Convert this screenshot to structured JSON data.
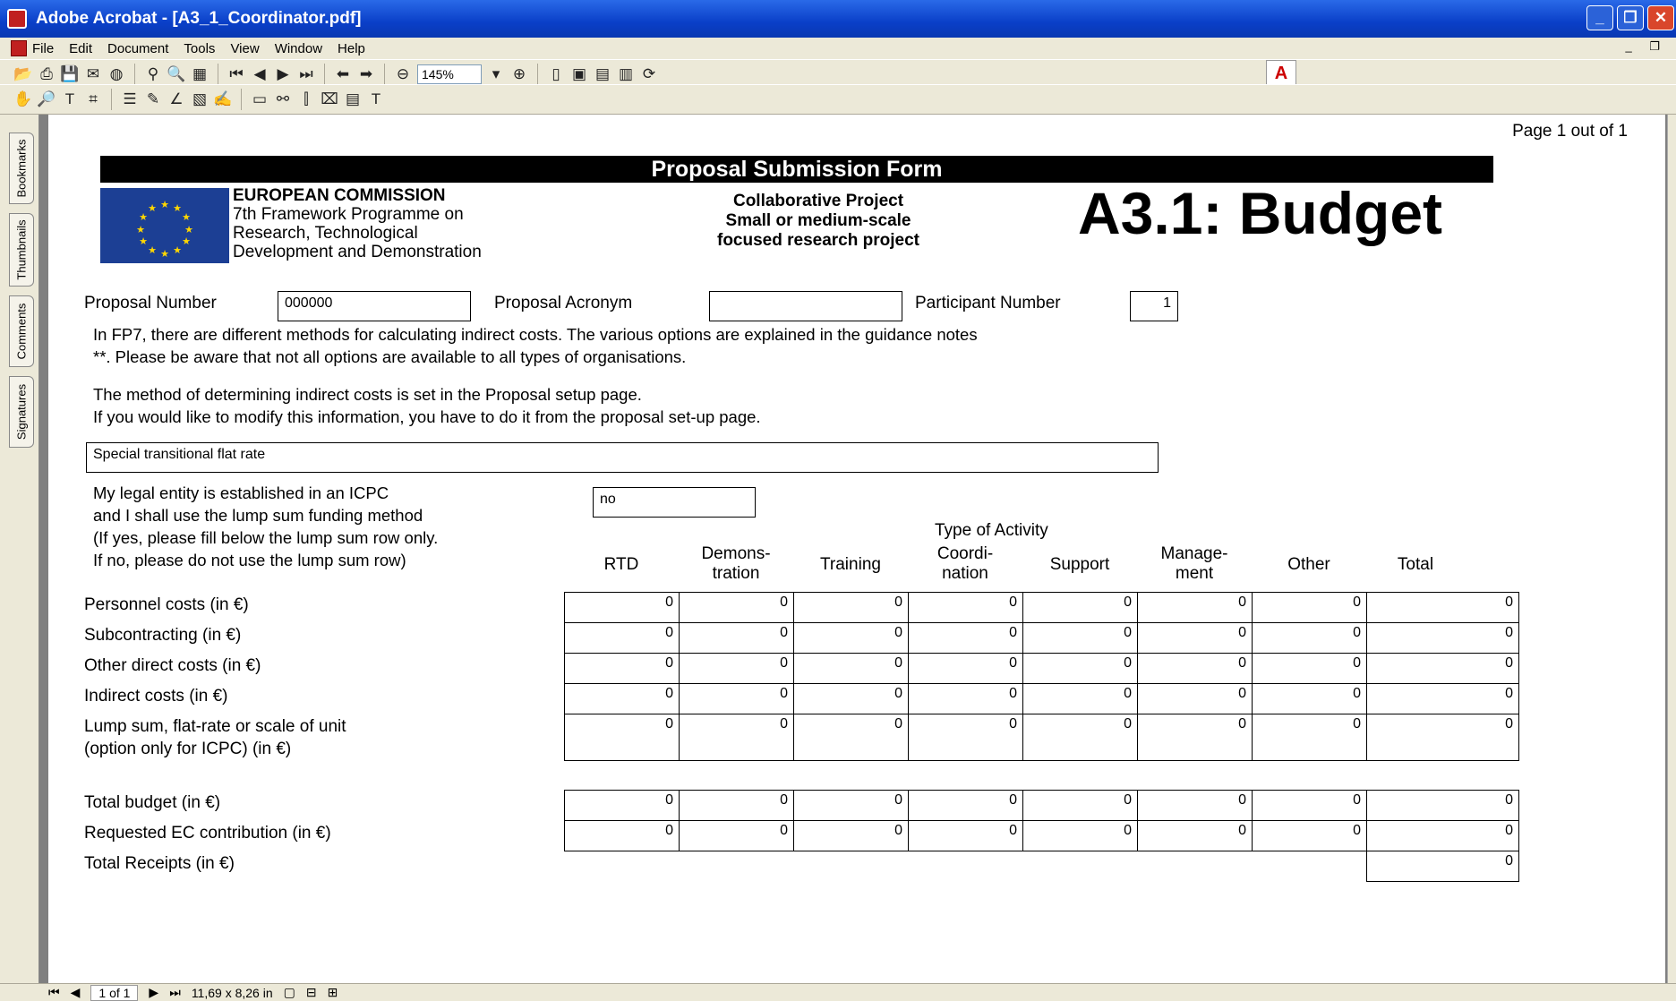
{
  "window": {
    "title": "Adobe Acrobat - [A3_1_Coordinator.pdf]"
  },
  "menu": [
    "File",
    "Edit",
    "Document",
    "Tools",
    "View",
    "Window",
    "Help"
  ],
  "toolbar": {
    "zoom": "145%"
  },
  "nav_tabs": [
    "Bookmarks",
    "Thumbnails",
    "Comments",
    "Signatures"
  ],
  "status": {
    "page": "1 of 1",
    "size": "11,69 x 8,26 in"
  },
  "doc": {
    "page_count": "Page 1 out of 1",
    "banner": "Proposal Submission Form",
    "ec": {
      "name": "EUROPEAN COMMISSION",
      "l1": "7th Framework Programme on",
      "l2": "Research, Technological",
      "l3": "Development and Demonstration"
    },
    "collab": {
      "l1": "Collaborative Project",
      "l2": "Small or medium-scale",
      "l3": "focused research project"
    },
    "title": "A3.1: Budget",
    "fields": {
      "proposal_number_label": "Proposal Number",
      "proposal_number": "000000",
      "acronym_label": "Proposal Acronym",
      "acronym": "",
      "participant_label": "Participant Number",
      "participant": "1"
    },
    "info1": "In FP7, there are different methods for calculating indirect costs. The various options are explained in the guidance notes",
    "info2": "**. Please be aware that not all options are available to all types of organisations.",
    "info3": "The method of determining indirect costs is set in the Proposal setup page.",
    "info4": "If you would like to modify this information, you have to do it from the proposal set-up page.",
    "method": "Special transitional flat rate",
    "icpc": {
      "l1": "My legal entity is established in an ICPC",
      "l2": "and I shall use the lump sum funding method",
      "l3": "(If yes, please fill below the lump sum row only.",
      "l4": "If no, please do not use the lump sum row)",
      "value": "no"
    },
    "activity_header": "Type of Activity",
    "columns": [
      {
        "l1": "RTD",
        "l2": ""
      },
      {
        "l1": "Demons-",
        "l2": "tration"
      },
      {
        "l1": "Training",
        "l2": ""
      },
      {
        "l1": "Coordi-",
        "l2": "nation"
      },
      {
        "l1": "Support",
        "l2": ""
      },
      {
        "l1": "Manage-",
        "l2": "ment"
      },
      {
        "l1": "Other",
        "l2": ""
      },
      {
        "l1": "Total",
        "l2": ""
      }
    ],
    "rows": [
      {
        "label": "Personnel costs (in €)",
        "label2": "",
        "values": [
          "0",
          "0",
          "0",
          "0",
          "0",
          "0",
          "0",
          "0"
        ]
      },
      {
        "label": "Subcontracting (in €)",
        "label2": "",
        "values": [
          "0",
          "0",
          "0",
          "0",
          "0",
          "0",
          "0",
          "0"
        ]
      },
      {
        "label": "Other direct costs (in €)",
        "label2": "",
        "values": [
          "0",
          "0",
          "0",
          "0",
          "0",
          "0",
          "0",
          "0"
        ]
      },
      {
        "label": "Indirect costs (in €)",
        "label2": "",
        "values": [
          "0",
          "0",
          "0",
          "0",
          "0",
          "0",
          "0",
          "0"
        ]
      },
      {
        "label": "Lump sum, flat-rate or scale of unit",
        "label2": "(option only for ICPC) (in €)",
        "values": [
          "0",
          "0",
          "0",
          "0",
          "0",
          "0",
          "0",
          "0"
        ]
      }
    ],
    "totals": [
      {
        "label": "Total budget (in €)",
        "values": [
          "0",
          "0",
          "0",
          "0",
          "0",
          "0",
          "0",
          "0"
        ]
      },
      {
        "label": "Requested EC contribution (in €)",
        "values": [
          "0",
          "0",
          "0",
          "0",
          "0",
          "0",
          "0",
          "0"
        ]
      }
    ],
    "receipts": {
      "label": "Total Receipts (in €)",
      "value": "0"
    }
  }
}
